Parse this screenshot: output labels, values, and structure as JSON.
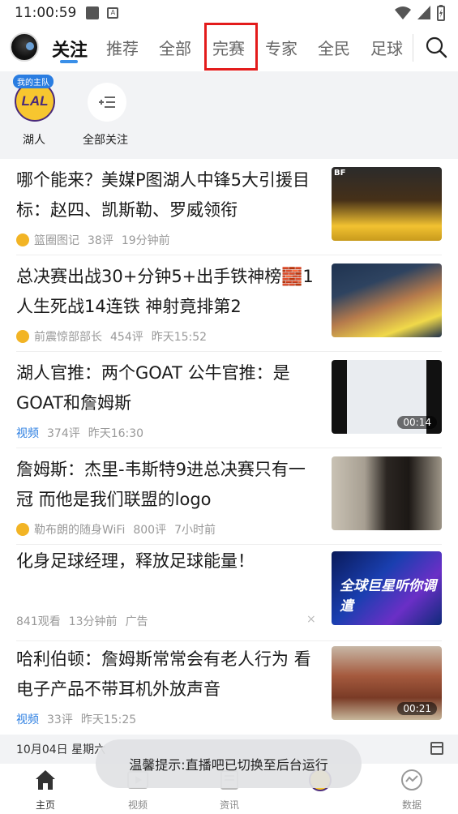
{
  "status_bar": {
    "time": "11:00:59"
  },
  "top_nav": {
    "tabs": [
      {
        "label": "关注",
        "active": true
      },
      {
        "label": "推荐"
      },
      {
        "label": "全部"
      },
      {
        "label": "完赛"
      },
      {
        "label": "专家"
      },
      {
        "label": "全民"
      },
      {
        "label": "足球"
      }
    ],
    "search_icon": "search-icon",
    "accent_color": "#3a8fe8",
    "highlight_color": "#e31b1b"
  },
  "follow": {
    "team": {
      "logo_text": "LAL",
      "tag": "我的主队",
      "name": "湖人"
    },
    "all_follow": {
      "label": "全部关注",
      "icon": "list-add-icon"
    }
  },
  "feed": [
    {
      "title": "哪个能来？美媒P图湖人中锋5大引援目标：赵四、凯斯勒、罗威领衔",
      "source": "篮圈图记",
      "comments": "38评",
      "time": "19分钟前",
      "thumb_label": "BF"
    },
    {
      "title": "总决赛出战30+分钟5+出手铁神榜🧱1人生死战14连铁 神射竟排第2",
      "source": "前震惊部部长",
      "comments": "454评",
      "time": "昨天15:52"
    },
    {
      "title": "湖人官推：两个GOAT 公牛官推：是GOAT和詹姆斯",
      "tag": "视频",
      "comments": "374评",
      "time": "昨天16:30",
      "duration": "00:14"
    },
    {
      "title": "詹姆斯：杰里-韦斯特9进总决赛只有一冠 而他是我们联盟的logo",
      "source": "勒布朗的随身WiFi",
      "comments": "800评",
      "time": "7小时前"
    },
    {
      "title": "化身足球经理，释放足球能量！",
      "views": "841观看",
      "time": "13分钟前",
      "ad": "广告",
      "thumb_text": "全球巨星听你调遣"
    },
    {
      "title": "哈利伯顿：詹姆斯常常会有老人行为 看电子产品不带耳机外放声音",
      "tag": "视频",
      "comments": "33评",
      "time": "昨天15:25",
      "duration": "00:21"
    }
  ],
  "date_bar": {
    "text": "10月04日 星期六"
  },
  "toast": {
    "text": "温馨提示:直播吧已切换至后台运行"
  },
  "bottom_bar": [
    {
      "label": "主页",
      "icon": "home-icon",
      "active": true
    },
    {
      "label": "视频",
      "icon": "video-icon"
    },
    {
      "label": "资讯",
      "icon": "news-icon"
    },
    {
      "label": "",
      "icon": "team-logo-icon"
    },
    {
      "label": "数据",
      "icon": "data-icon"
    }
  ]
}
